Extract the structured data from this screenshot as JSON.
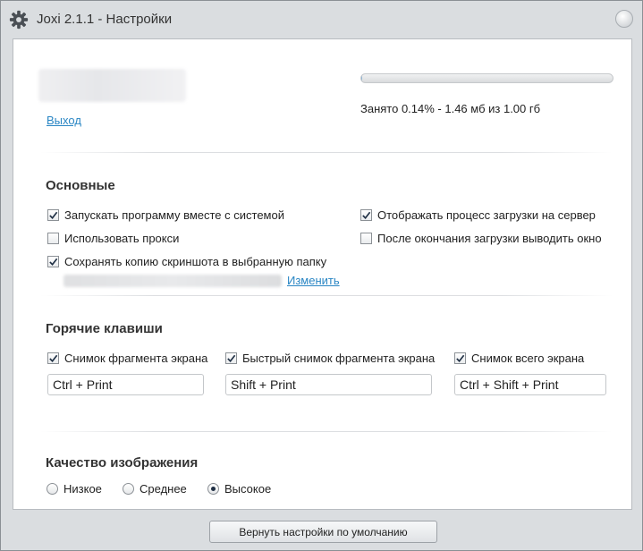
{
  "window": {
    "title": "Joxi 2.1.1 - Настройки",
    "icon": "gear-icon"
  },
  "account": {
    "logout_label": "Выход",
    "storage_used_fraction": 0.0014,
    "storage_text": "Занято 0.14% - 1.46 мб из 1.00 гб"
  },
  "general": {
    "title": "Основные",
    "options": [
      {
        "label": "Запускать программу вместе с системой",
        "checked": true
      },
      {
        "label": "Отображать процесс загрузки на сервер",
        "checked": true
      },
      {
        "label": "Использовать прокси",
        "checked": false
      },
      {
        "label": "После окончания загрузки выводить окно",
        "checked": false
      },
      {
        "label": "Сохранять копию скриншота в выбранную папку",
        "checked": true
      }
    ],
    "change_label": "Изменить"
  },
  "hotkeys": {
    "title": "Горячие клавиши",
    "items": [
      {
        "label": "Снимок фрагмента экрана",
        "checked": true,
        "value": "Ctrl + Print"
      },
      {
        "label": "Быстрый снимок фрагмента экрана",
        "checked": true,
        "value": "Shift + Print"
      },
      {
        "label": "Снимок всего экрана",
        "checked": true,
        "value": "Ctrl + Shift + Print"
      }
    ]
  },
  "quality": {
    "title": "Качество изображения",
    "options": [
      {
        "label": "Низкое",
        "selected": false
      },
      {
        "label": "Среднее",
        "selected": false
      },
      {
        "label": "Высокое",
        "selected": true
      }
    ]
  },
  "footer": {
    "reset_label": "Вернуть настройки по умолчанию"
  }
}
